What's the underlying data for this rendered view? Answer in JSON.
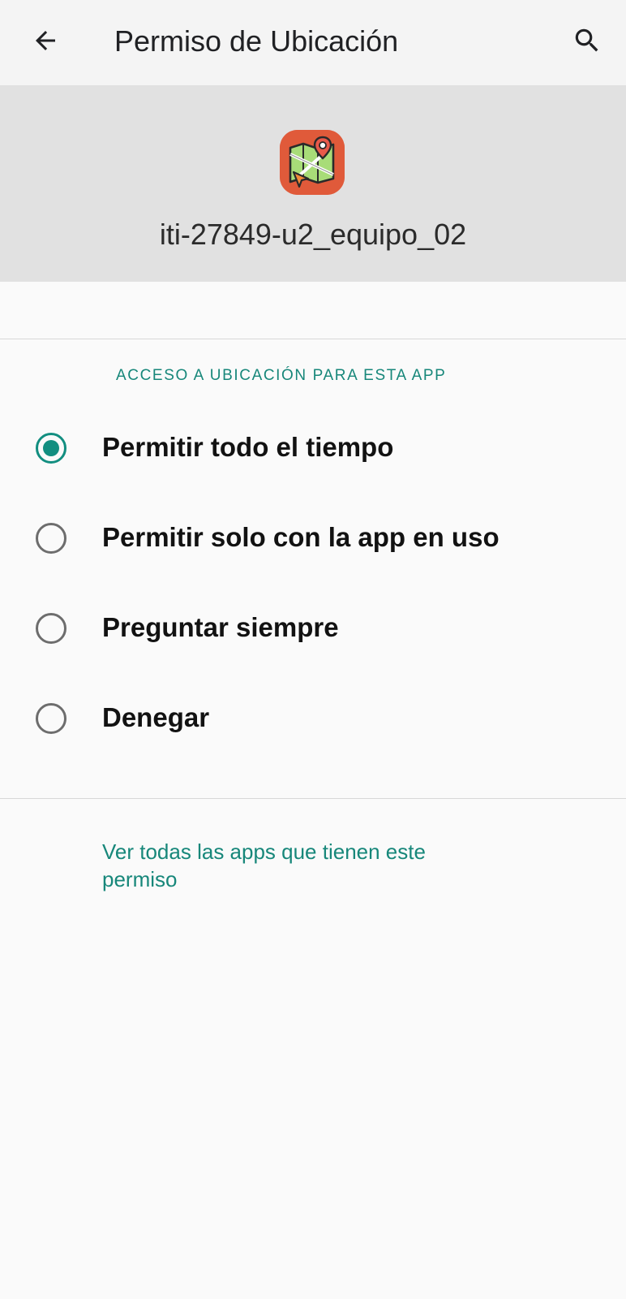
{
  "app_bar": {
    "title": "Permiso de Ubicación",
    "back_icon": "arrow-back-icon",
    "search_icon": "search-icon"
  },
  "app_header": {
    "app_name": "iti-27849-u2_equipo_02",
    "app_icon": "map-pin-icon"
  },
  "section": {
    "header": "ACCESO A UBICACIÓN PARA ESTA APP"
  },
  "options": [
    {
      "label": "Permitir todo el tiempo",
      "selected": true
    },
    {
      "label": "Permitir solo con la app en uso",
      "selected": false
    },
    {
      "label": "Preguntar siempre",
      "selected": false
    },
    {
      "label": "Denegar",
      "selected": false
    }
  ],
  "footer": {
    "link_text": "Ver todas las apps que tienen este permiso"
  },
  "colors": {
    "accent": "#128e80",
    "app_bar_bg": "#f4f4f4",
    "header_bg": "#e1e1e1",
    "app_icon_bg": "#e05a3a"
  }
}
